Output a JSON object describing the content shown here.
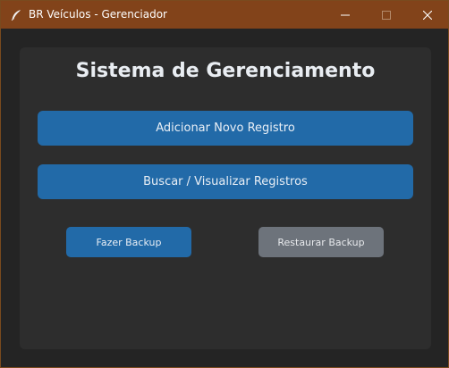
{
  "window": {
    "title": "BR Veículos - Gerenciador",
    "icon": "feather-icon",
    "controls": [
      "minimize-icon",
      "maximize-icon",
      "close-icon"
    ]
  },
  "main": {
    "heading": "Sistema de Gerenciamento",
    "add_button": "Adicionar Novo Registro",
    "search_button": "Buscar / Visualizar Registros",
    "backup_button": "Fazer Backup",
    "restore_button": "Restaurar Backup"
  },
  "colors": {
    "titlebar": "#82431a",
    "primary": "#226aa8",
    "secondary": "#6d737b",
    "background": "#242424",
    "panel": "#2d2d2d"
  }
}
